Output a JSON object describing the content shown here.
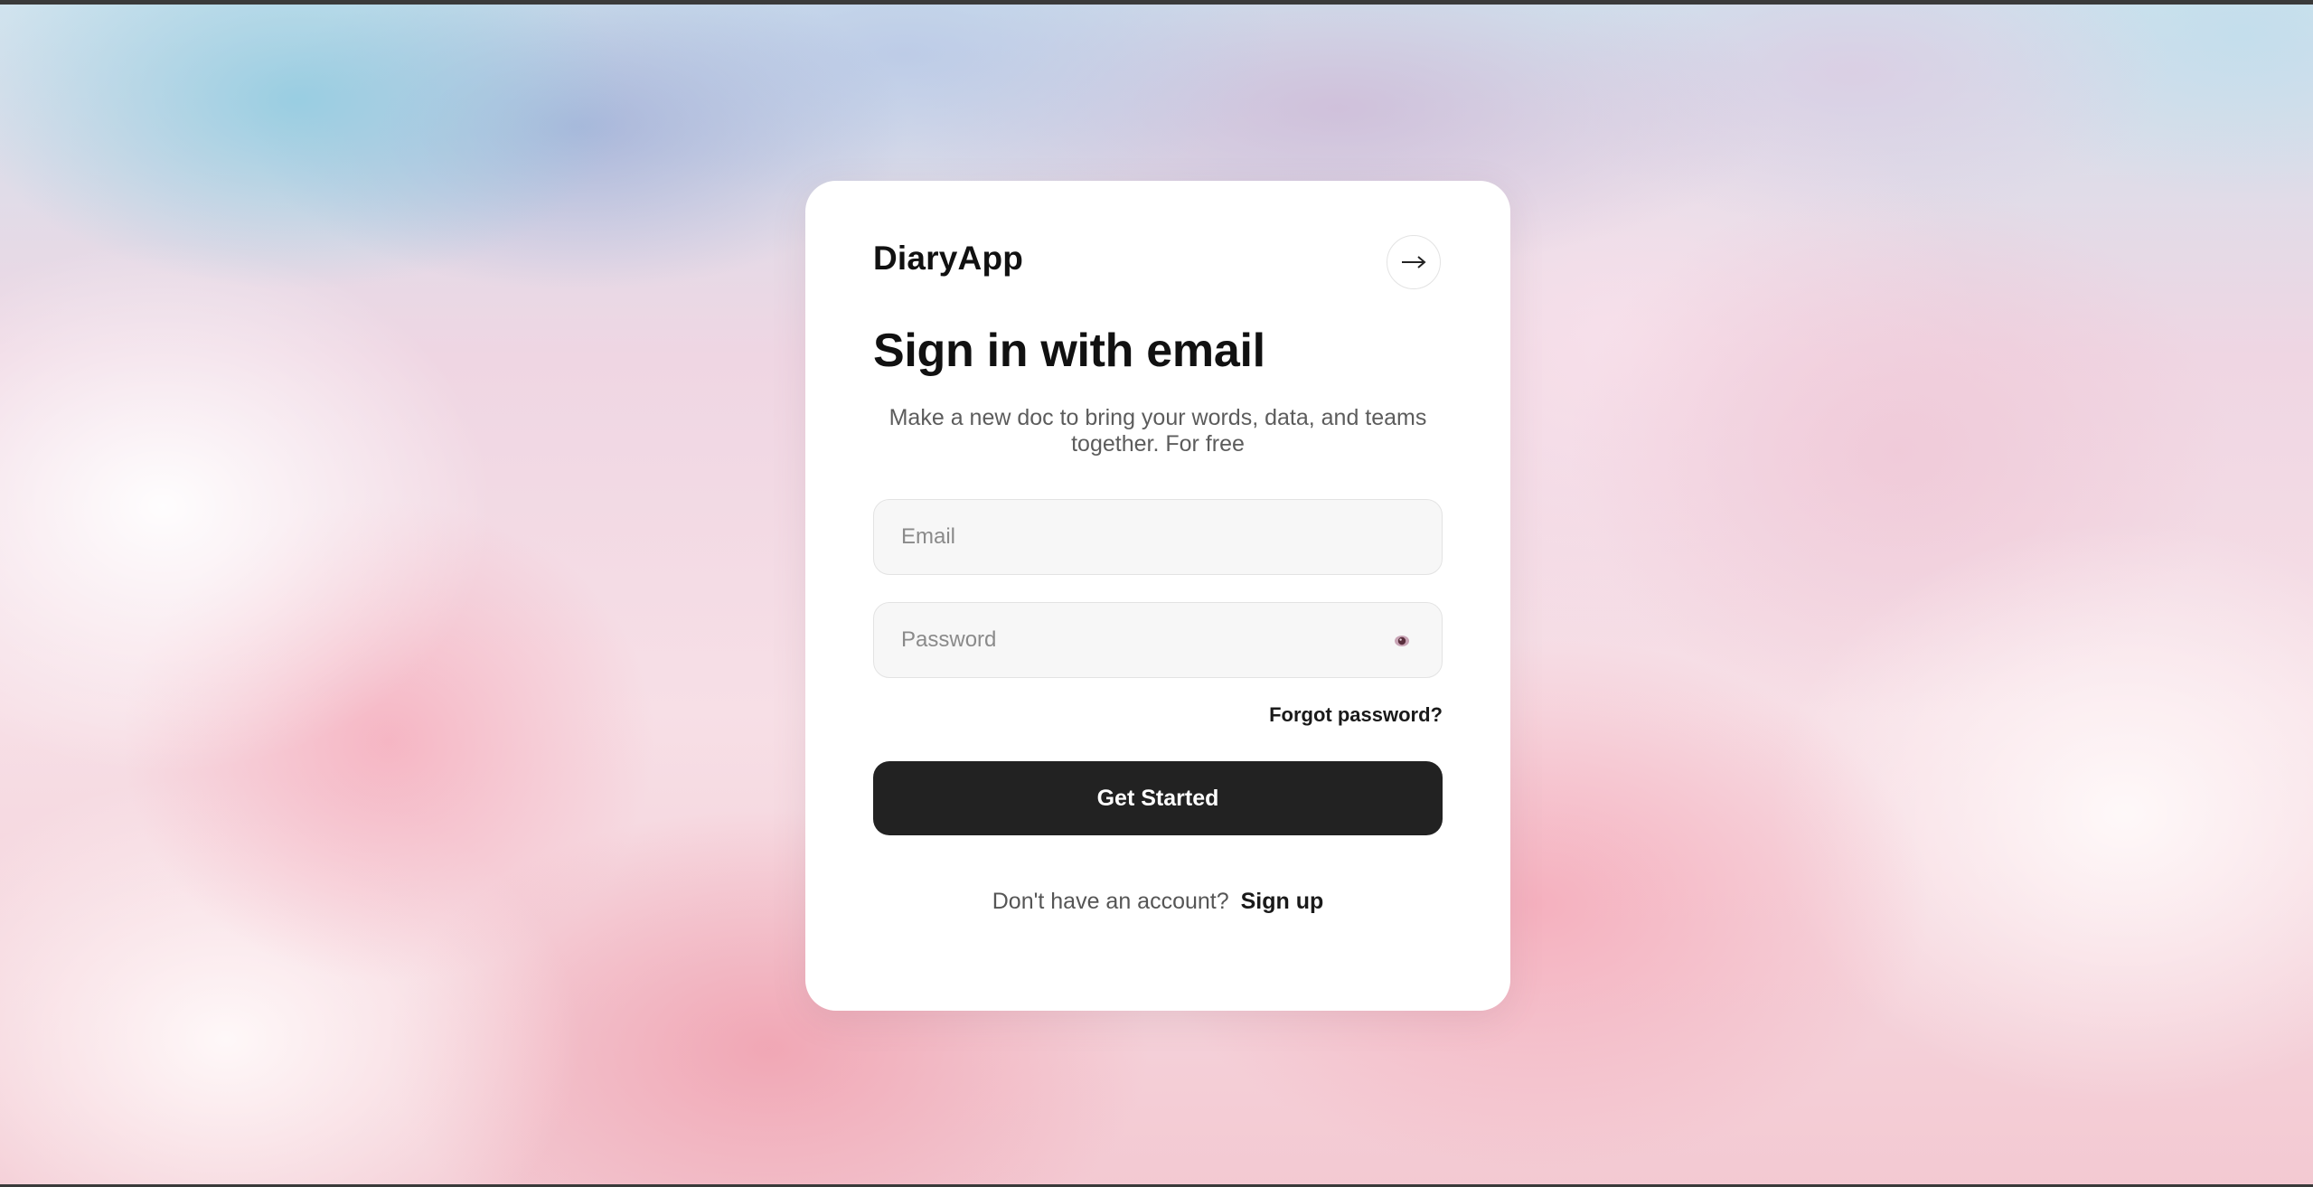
{
  "app": {
    "brand": "DiaryApp"
  },
  "header": {
    "action_icon": "arrow-right-icon"
  },
  "form": {
    "title": "Sign in with email",
    "subtitle": "Make a new doc to bring your words, data, and teams together. For free",
    "email": {
      "placeholder": "Email",
      "value": ""
    },
    "password": {
      "placeholder": "Password",
      "value": "",
      "toggle_icon": "eye-icon"
    },
    "forgot_label": "Forgot password?",
    "submit_label": "Get Started",
    "signup_prompt": "Don't have an account?",
    "signup_label": "Sign up"
  },
  "colors": {
    "card": "#ffffff",
    "primary_button": "#222222",
    "primary_button_text": "#ffffff",
    "field_background": "#f7f7f7",
    "muted_text": "#5c5c5c"
  }
}
